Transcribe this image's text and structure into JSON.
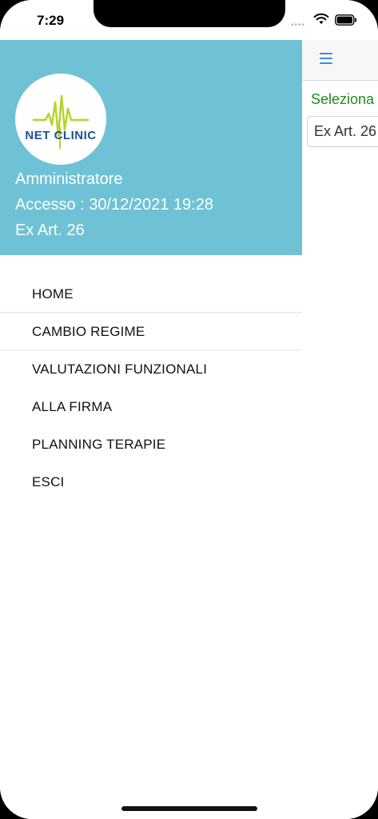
{
  "status_bar": {
    "time": "7:29",
    "dots": "••••"
  },
  "drawer": {
    "logo": {
      "text": "NET CLINIC"
    },
    "header": {
      "user_role": "Amministratore",
      "last_access": "Accesso : 30/12/2021 19:28",
      "regime": "Ex Art. 26"
    },
    "menu_items": [
      {
        "label": "HOME"
      },
      {
        "label": "CAMBIO REGIME"
      },
      {
        "label": "VALUTAZIONI FUNZIONALI"
      },
      {
        "label": "ALLA FIRMA"
      },
      {
        "label": "PLANNING TERAPIE"
      },
      {
        "label": "ESCI"
      }
    ]
  },
  "background_app": {
    "select_label": "Seleziona",
    "select_value": "Ex Art. 26"
  },
  "colors": {
    "header_bg": "#6fc2d5",
    "accent_blue": "#3b8fd6",
    "label_green": "#1e8c1e",
    "logo_blue": "#1f4f9c",
    "logo_green": "#b7d22b"
  }
}
